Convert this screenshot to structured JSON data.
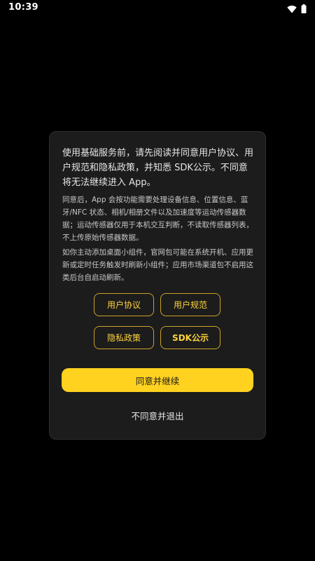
{
  "status_bar": {
    "time": "10:39",
    "icons": [
      "wifi-icon",
      "battery-icon"
    ]
  },
  "dialog": {
    "intro": "使用基础服务前，请先阅读并同意用户协议、用户规范和隐私政策，并知悉 SDK公示。不同意将无法继续进入 App。",
    "paragraph_1": "同意后，App 会按功能需要处理设备信息、位置信息、蓝牙/NFC 状态、相机/相册文件以及加速度等运动传感器数据；运动传感器仅用于本机交互判断，不读取传感器列表，不上传原始传感器数据。",
    "paragraph_2": "如你主动添加桌面小组件，官网包可能在系统开机、应用更新或定时任务触发时刷新小组件；应用市场渠道包不启用这类后台自启动刷新。",
    "links": {
      "user_agreement": "用户协议",
      "user_norms": "用户规范",
      "privacy_policy": "隐私政策",
      "sdk_disclosure": "SDK公示"
    },
    "agree_label": "同意并继续",
    "decline_label": "不同意并退出"
  },
  "colors": {
    "background": "#000000",
    "dialog_background": "#1c1c1c",
    "accent": "#ffd21f",
    "link_text": "#ffd43b",
    "link_border": "#c9a227"
  }
}
